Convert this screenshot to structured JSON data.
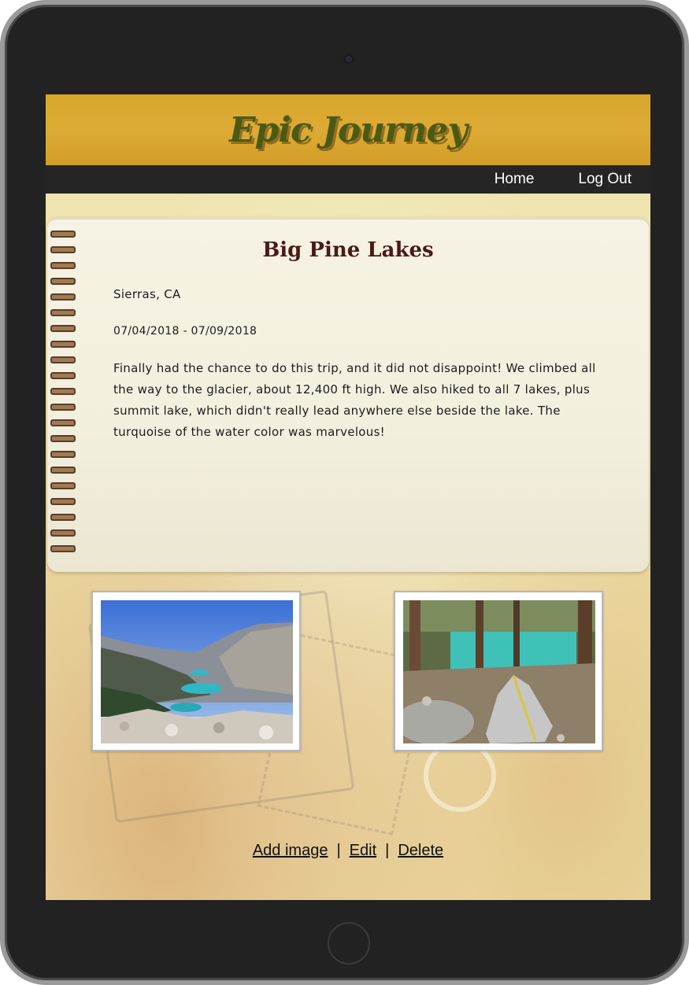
{
  "app": {
    "brand": "Epic Journey"
  },
  "nav": {
    "items": [
      {
        "label": "Home"
      },
      {
        "label": "Log Out"
      }
    ]
  },
  "entry": {
    "title": "Big Pine Lakes",
    "location": "Sierras, CA",
    "dates": "07/04/2018 - 07/09/2018",
    "description": "Finally had the chance to do this trip, and it did not disappoint! We climbed all the way to the glacier, about 12,400 ft high. We also hiked to all 7 lakes, plus summit lake, which didn't really lead anywhere else beside the lake. The turquoise of the water color was marvelous!"
  },
  "photos": [
    {
      "subject": "alpine lakes viewed from mountain ridge"
    },
    {
      "subject": "grey tent in pine forest near turquoise lake"
    }
  ],
  "actions": {
    "add_image": "Add image",
    "edit": "Edit",
    "delete": "Delete",
    "separator": "|"
  },
  "colors": {
    "header_bg": "#d9a52c",
    "brand_text": "#4a5a14",
    "nav_bg": "#252525",
    "title_text": "#4a1a16"
  }
}
